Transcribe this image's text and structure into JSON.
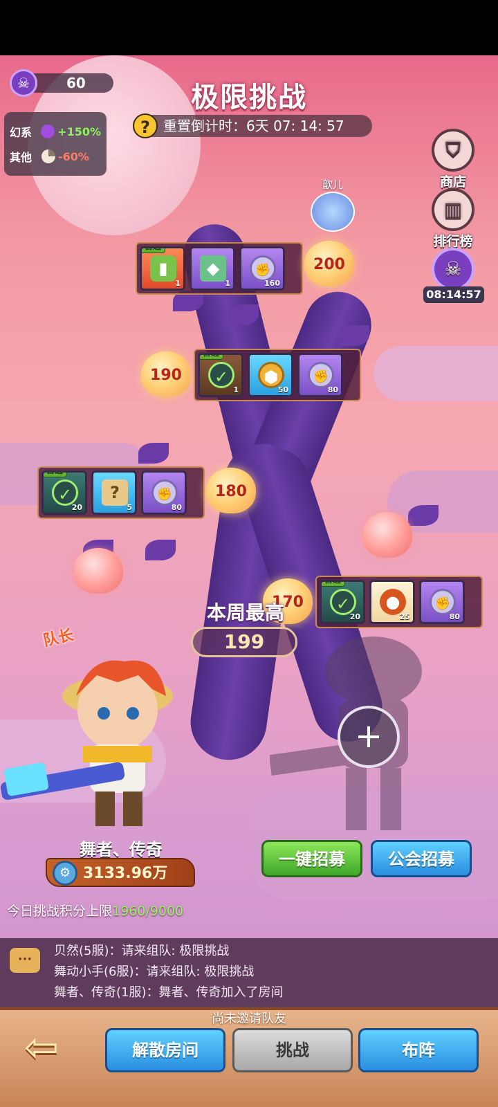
{
  "resource": {
    "icon": "skull-badge-icon",
    "count": "60"
  },
  "buffs": [
    {
      "label": "幻系",
      "icon": "potion-icon",
      "value": "+150%"
    },
    {
      "label": "其他",
      "icon": "pie-icon",
      "value": "-60%"
    }
  ],
  "title": "极限挑战",
  "timer": {
    "help": "?",
    "text": "重置倒计时：6天 07: 14: 57"
  },
  "side": {
    "shop": "商店",
    "rank": "排行榜",
    "event_time": "08:14:57"
  },
  "top_player": "歆儿",
  "first_clear_label": "首通",
  "stages": [
    {
      "level": "200",
      "rewards": [
        {
          "icon": "energy-battery-icon",
          "count": "1"
        },
        {
          "icon": "gem-chest-icon",
          "count": "1"
        },
        {
          "icon": "fist-coin-icon",
          "count": "160"
        }
      ]
    },
    {
      "level": "190",
      "rewards": [
        {
          "icon": "check-icon",
          "count": "1"
        },
        {
          "icon": "gold-coin-icon",
          "count": "50"
        },
        {
          "icon": "fist-coin-icon",
          "count": "80"
        }
      ]
    },
    {
      "level": "180",
      "rewards": [
        {
          "icon": "check-icon",
          "count": "20"
        },
        {
          "icon": "mystery-map-icon",
          "count": "5"
        },
        {
          "icon": "fist-coin-icon",
          "count": "80"
        }
      ]
    },
    {
      "level": "170",
      "rewards": [
        {
          "icon": "check-icon",
          "count": "20"
        },
        {
          "icon": "pet-food-icon",
          "count": "25"
        },
        {
          "icon": "fist-coin-icon",
          "count": "80"
        }
      ]
    }
  ],
  "weekly": {
    "label": "本周最高",
    "value": "199"
  },
  "captain_label": "队长",
  "hero": {
    "name": "舞者、传奇",
    "power": "3133.96万"
  },
  "buttons": {
    "quick_recruit": "一键招募",
    "guild_recruit": "公会招募",
    "disband": "解散房间",
    "challenge": "挑战",
    "formation": "布阵"
  },
  "daily_limit": {
    "label": "今日挑战积分上限",
    "value": "1960/9000"
  },
  "chat": [
    "贝然(5服)：请来组队: 极限挑战",
    "舞动小手(6服)：请来组队: 极限挑战",
    "舞者、传奇(1服)：舞者、传奇加入了房间"
  ],
  "invite_note": "尚未邀请队友",
  "colors": {
    "accent_green": "#9ef06a",
    "accent_red": "#ff7d66",
    "title_shadow": "#b03c5a"
  }
}
